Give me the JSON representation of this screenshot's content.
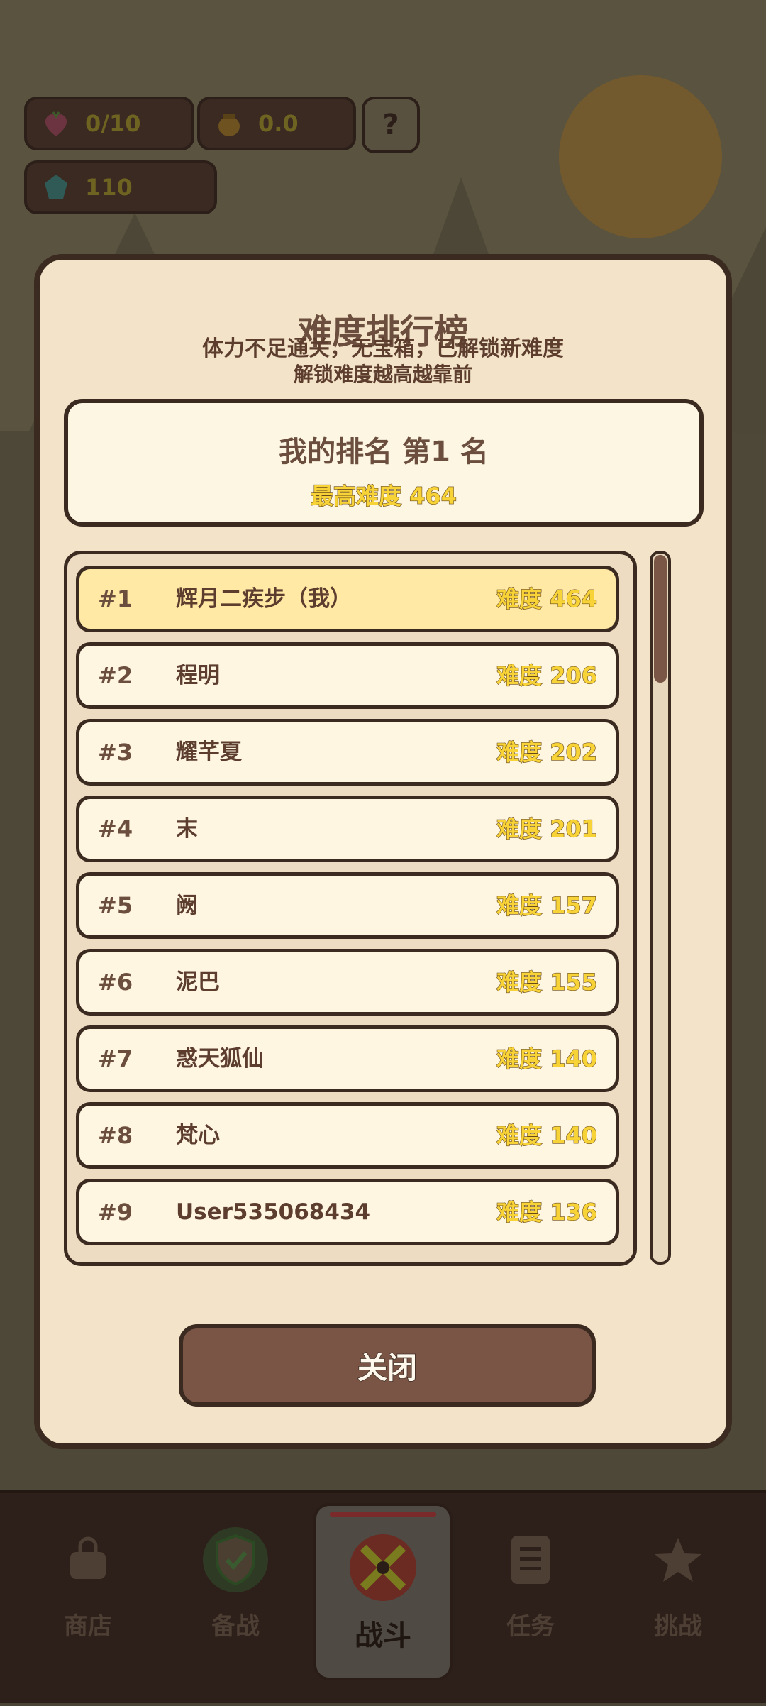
{
  "resources": {
    "energy": {
      "icon": "heart-berry-icon",
      "value": "0/10"
    },
    "honey": {
      "icon": "honey-pot-icon",
      "value": "0.0"
    },
    "gems": {
      "icon": "gem-icon",
      "value": "110"
    },
    "help_label": "?"
  },
  "modal": {
    "title": "难度排行榜",
    "subtitle1": "体力不足通关，无宝箱，已解锁新难度",
    "subtitle2": "解锁难度越高越靠前",
    "my_rank": "我的排名 第1 名",
    "best_difficulty": "最高难度 464",
    "close_label": "关闭",
    "scroll_position": 0,
    "leaderboard": [
      {
        "rank": "#1",
        "name": "辉月二疾步（我）",
        "difficulty": "难度 464",
        "is_me": true
      },
      {
        "rank": "#2",
        "name": "程明",
        "difficulty": "难度 206",
        "is_me": false
      },
      {
        "rank": "#3",
        "name": "耀芊夏",
        "difficulty": "难度 202",
        "is_me": false
      },
      {
        "rank": "#4",
        "name": "末",
        "difficulty": "难度 201",
        "is_me": false
      },
      {
        "rank": "#5",
        "name": "阙",
        "difficulty": "难度 157",
        "is_me": false
      },
      {
        "rank": "#6",
        "name": "泥巴",
        "difficulty": "难度 155",
        "is_me": false
      },
      {
        "rank": "#7",
        "name": "惑天狐仙",
        "difficulty": "难度 140",
        "is_me": false
      },
      {
        "rank": "#8",
        "name": "梵心",
        "difficulty": "难度 140",
        "is_me": false
      },
      {
        "rank": "#9",
        "name": "User535068434",
        "difficulty": "难度 136",
        "is_me": false
      }
    ]
  },
  "nav": {
    "items": [
      {
        "label": "商店",
        "icon": "shop-bag-icon"
      },
      {
        "label": "备战",
        "icon": "shield-check-icon"
      },
      {
        "label": "战斗",
        "icon": "crossed-swords-icon",
        "active": true
      },
      {
        "label": "任务",
        "icon": "task-list-icon"
      },
      {
        "label": "挑战",
        "icon": "star-icon"
      }
    ]
  },
  "colors": {
    "accent_yellow": "#f7d338",
    "text_brown": "#6b4e3d",
    "border_dark": "#3a2a20",
    "panel_bg": "#f3e3c8",
    "highlight_row": "#ffe9a5"
  }
}
